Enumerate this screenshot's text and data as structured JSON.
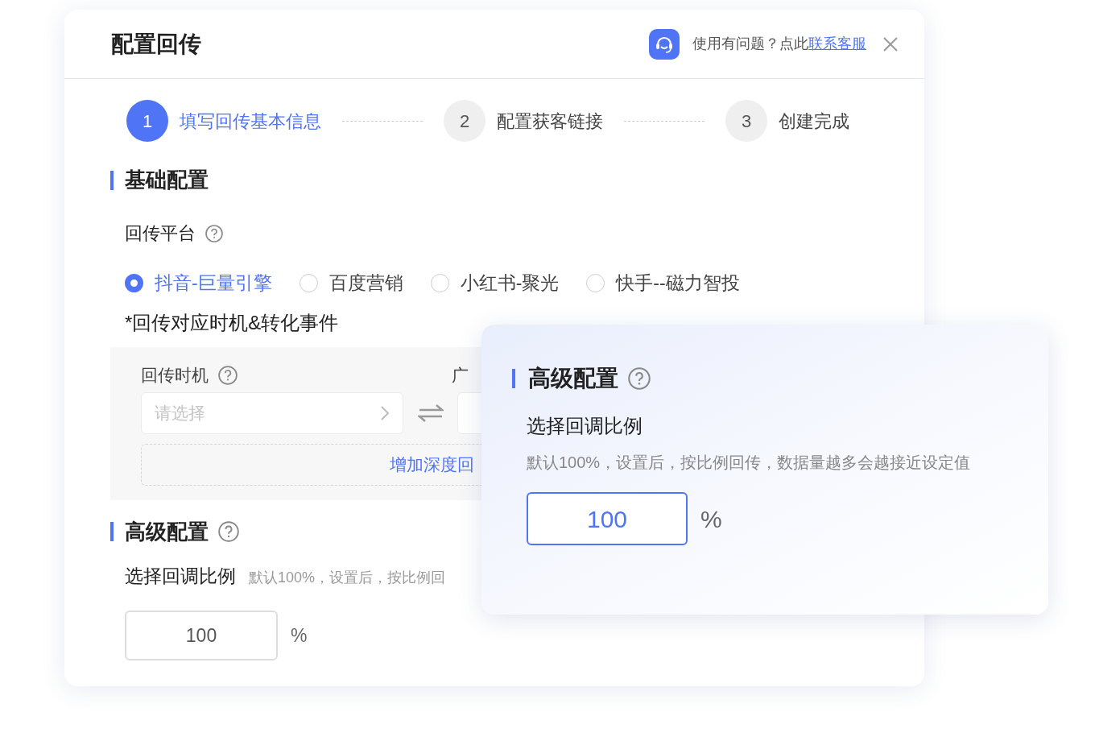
{
  "dialog": {
    "title": "配置回传",
    "help_text": "使用有问题？点此",
    "help_link": "联系客服"
  },
  "steps": [
    {
      "number": "1",
      "label": "填写回传基本信息",
      "selected": true
    },
    {
      "number": "2",
      "label": "配置获客链接",
      "selected": false
    },
    {
      "number": "3",
      "label": "创建完成",
      "selected": false
    }
  ],
  "basic": {
    "title": "基础配置",
    "platform_label": "回传平台",
    "platforms": [
      {
        "label": "抖音-巨量引擎",
        "selected": true
      },
      {
        "label": "百度营销",
        "selected": false
      },
      {
        "label": "小红书-聚光",
        "selected": false
      },
      {
        "label": "快手--磁力智投",
        "selected": false
      }
    ],
    "events_label": "*回传对应时机&转化事件",
    "timing_label": "回传时机",
    "timing_placeholder": "请选择",
    "ad_label": "广",
    "add_button": "增加深度回"
  },
  "advanced": {
    "title": "高级配置",
    "ratio_label": "选择回调比例",
    "hint": "默认100%，设置后，按比例回",
    "value": "100",
    "unit": "%"
  },
  "popup": {
    "title": "高级配置",
    "ratio_label": "选择回调比例",
    "hint": "默认100%，设置后，按比例回传，数据量越多会越接近设定值",
    "value": "100",
    "unit": "%"
  }
}
